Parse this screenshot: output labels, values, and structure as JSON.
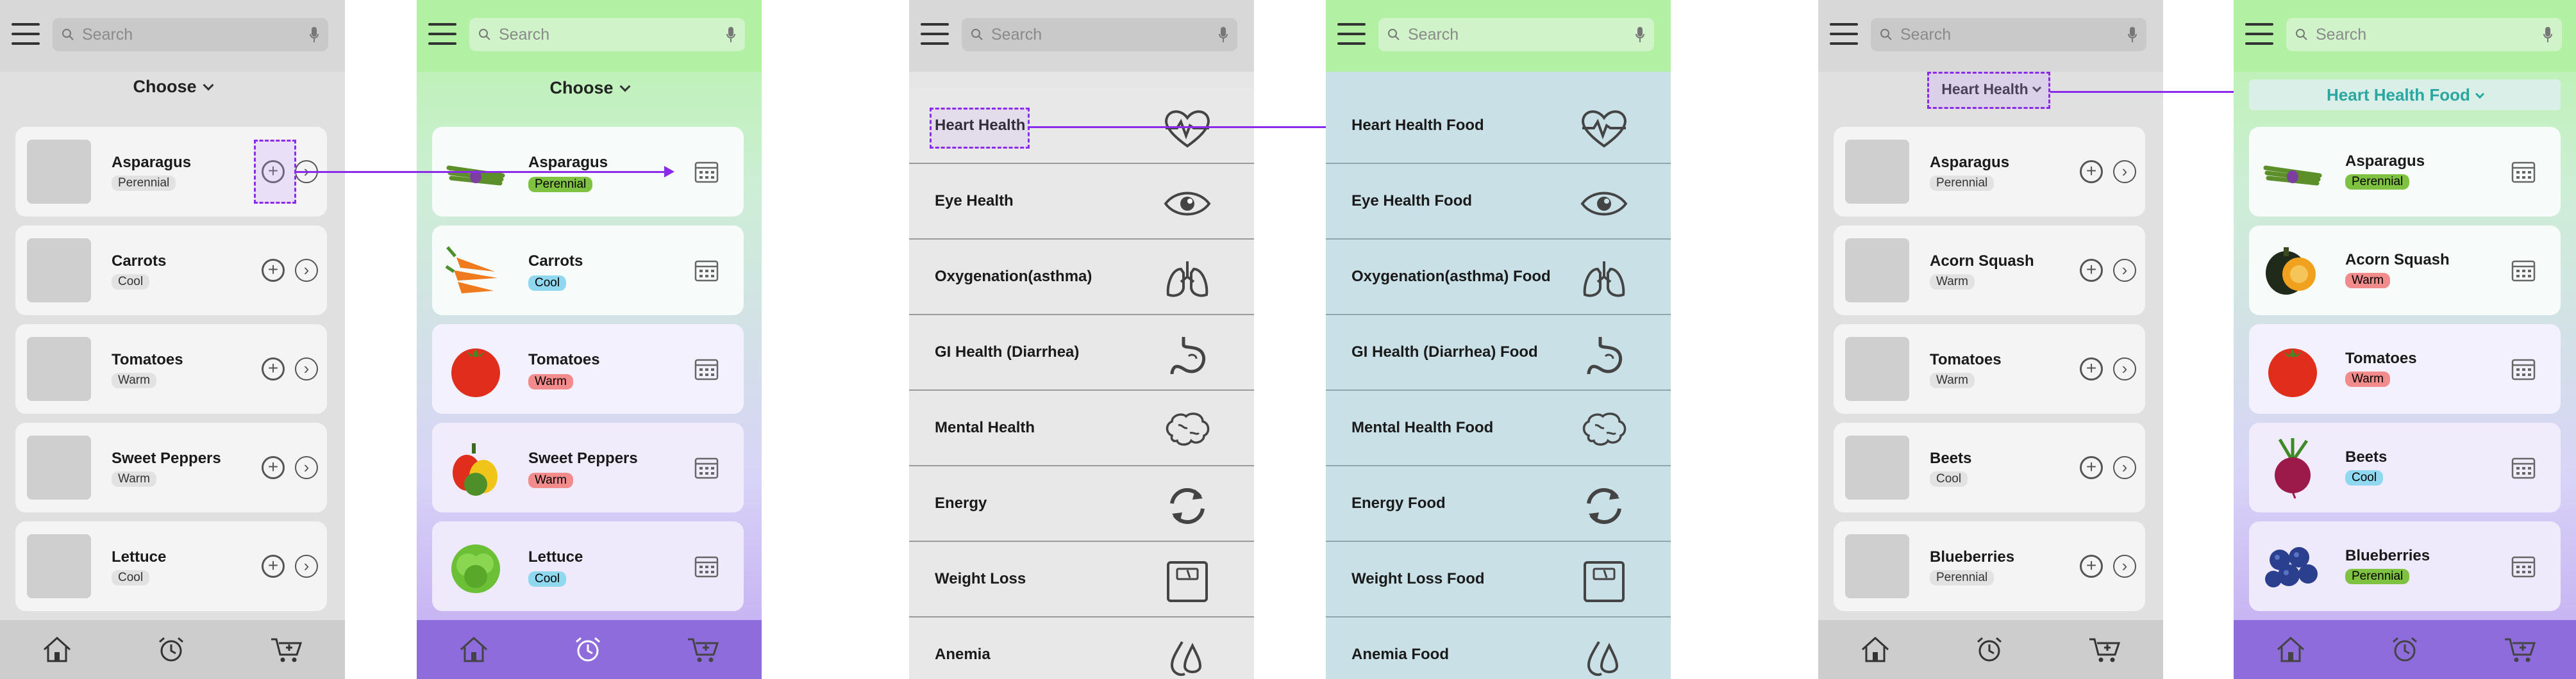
{
  "search_placeholder": "Search",
  "choose_label": "Choose",
  "phone1": {
    "items": [
      {
        "name": "Asparagus",
        "tag": "Perennial"
      },
      {
        "name": "Carrots",
        "tag": "Cool"
      },
      {
        "name": "Tomatoes",
        "tag": "Warm"
      },
      {
        "name": "Sweet Peppers",
        "tag": "Warm"
      },
      {
        "name": "Lettuce",
        "tag": "Cool"
      }
    ]
  },
  "phone2": {
    "items": [
      {
        "name": "Asparagus",
        "tag": "Perennial",
        "tag_color": "#7fc241"
      },
      {
        "name": "Carrots",
        "tag": "Cool",
        "tag_color": "#8fd8f0"
      },
      {
        "name": "Tomatoes",
        "tag": "Warm",
        "tag_color": "#f28b8b"
      },
      {
        "name": "Sweet Peppers",
        "tag": "Warm",
        "tag_color": "#f28b8b"
      },
      {
        "name": "Lettuce",
        "tag": "Cool",
        "tag_color": "#8fd8f0"
      }
    ]
  },
  "health_menu": [
    {
      "label": "Heart Health",
      "icon": "heart-pulse-icon"
    },
    {
      "label": "Eye Health",
      "icon": "eye-icon"
    },
    {
      "label": "Oxygenation(asthma)",
      "icon": "lungs-icon"
    },
    {
      "label": "GI Health (Diarrhea)",
      "icon": "stomach-icon"
    },
    {
      "label": "Mental Health",
      "icon": "brain-icon"
    },
    {
      "label": "Energy",
      "icon": "refresh-icon"
    },
    {
      "label": "Weight Loss",
      "icon": "scale-icon"
    },
    {
      "label": "Anemia",
      "icon": "drop-icon"
    }
  ],
  "food_menu": [
    {
      "label": "Heart Health Food"
    },
    {
      "label": "Eye Health Food"
    },
    {
      "label": "Oxygenation(asthma) Food"
    },
    {
      "label": "GI Health (Diarrhea) Food"
    },
    {
      "label": "Mental Health Food"
    },
    {
      "label": "Energy Food"
    },
    {
      "label": "Weight Loss Food"
    },
    {
      "label": "Anemia Food"
    }
  ],
  "phone5": {
    "filter_label": "Heart Health",
    "items": [
      {
        "name": "Asparagus",
        "tag": "Perennial"
      },
      {
        "name": "Acorn Squash",
        "tag": "Warm"
      },
      {
        "name": "Tomatoes",
        "tag": "Warm"
      },
      {
        "name": "Beets",
        "tag": "Cool"
      },
      {
        "name": "Blueberries",
        "tag": "Perennial"
      }
    ]
  },
  "phone6": {
    "filter_label": "Heart Health Food",
    "items": [
      {
        "name": "Asparagus",
        "tag": "Perennial",
        "tag_color": "#7fc241"
      },
      {
        "name": "Acorn Squash",
        "tag": "Warm",
        "tag_color": "#f28b8b"
      },
      {
        "name": "Tomatoes",
        "tag": "Warm",
        "tag_color": "#f28b8b"
      },
      {
        "name": "Beets",
        "tag": "Cool",
        "tag_color": "#8fd8f0"
      },
      {
        "name": "Blueberries",
        "tag": "Perennial",
        "tag_color": "#7fc241"
      }
    ]
  },
  "colors": {
    "accent": "#8b2ae8",
    "phone_green_top": "#b7f3a8",
    "phone_purple_bottom": "#8f6cdc",
    "food_blue": "#c9e0e6",
    "filter_teal": "#2aa7a0"
  },
  "nav_icons": [
    "home-icon",
    "alarm-icon",
    "cart-icon"
  ]
}
